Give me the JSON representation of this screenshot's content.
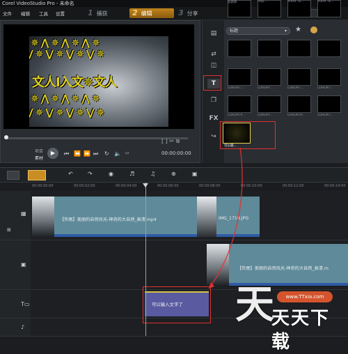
{
  "window": {
    "title": "Corel VideoStudio Pro - 未命名"
  },
  "menu": [
    "文件",
    "编辑",
    "工具",
    "设置"
  ],
  "steps": [
    {
      "num": "1",
      "label": "捕获"
    },
    {
      "num": "2",
      "label": "编辑"
    },
    {
      "num": "3",
      "label": "分享"
    }
  ],
  "preview": {
    "overlay_text": "文人I入文",
    "mode_labels": {
      "project": "项目",
      "clip": "素材"
    },
    "timecode": "00:00:00:00"
  },
  "library": {
    "category": "标题",
    "thumbs": [
      {
        "label": ""
      },
      {
        "label": ""
      },
      {
        "label": ""
      },
      {
        "label": ""
      },
      {
        "label": "LOREM I..."
      },
      {
        "label": "LOREM I..."
      },
      {
        "label": "LOREM I..."
      },
      {
        "label": "LOREM I..."
      },
      {
        "label": "LOREM IP..."
      },
      {
        "label": "LOREM I..."
      },
      {
        "label": "LOREM IP..."
      },
      {
        "label": "LOREM I..."
      },
      {
        "label": "标题库"
      },
      {
        "label": "http:..."
      },
      {
        "label": "YOUR TE..."
      },
      {
        "label": "YOUR TE..."
      },
      {
        "label": "可以输..."
      }
    ]
  },
  "ruler": [
    "00:00:00:00",
    "00:00:02:00",
    "00:00:04:00",
    "00:00:06:00",
    "00:00:08:00",
    "00:00:10:00",
    "00:00:12:00",
    "00:00:14:00"
  ],
  "timeline": {
    "video_clip": "【失眠】美丽的自然风光-神奇的大自然_高清.mp4",
    "image_clip": "IMG_1719.JPG",
    "overlay_clip": "【失眠】美丽的自然风光-神奇的大自然_高清.m",
    "title_clip": "可以输入文字了"
  },
  "watermark": {
    "small": "www.TTxia.com",
    "big": "天天下载"
  },
  "colors": {
    "accent": "#c2851c",
    "highlight": "#e03232",
    "title_clip": "#595aa0",
    "video_clip": "#5f8a99"
  }
}
